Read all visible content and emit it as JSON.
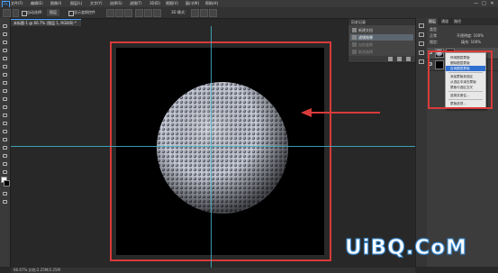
{
  "app": {
    "logo": "Ps",
    "menus": [
      "文件(F)",
      "编辑(E)",
      "图像(I)",
      "图层(L)",
      "文字(Y)",
      "选择(S)",
      "滤镜(T)",
      "3D(D)",
      "视图(V)",
      "窗口(W)",
      "帮助(H)"
    ],
    "window_controls": [
      "—",
      "□",
      "✕"
    ]
  },
  "options_bar": {
    "auto_select_label": "自动选择：",
    "auto_select_target": "图层",
    "show_transform_label": "显示变换控件",
    "mode_3d_label": "3D 模式："
  },
  "document": {
    "tab_label": "未标题-1 @ 66.7% (图层 1, RGB/8) *",
    "status_text": "66.67%   文档:2.25M/2.25M"
  },
  "canvas": {
    "background_color": "#282828",
    "artboard_color": "#000000",
    "highlight_color": "#d93a3a",
    "guide_color": "#3fb4c8"
  },
  "history_panel": {
    "title": "历史记录",
    "items": [
      {
        "label": "新建文档",
        "state": "normal"
      },
      {
        "label": "滤镜效果",
        "state": "selected"
      },
      {
        "label": "自由变换",
        "state": "dimmed"
      },
      {
        "label": "取消选择",
        "state": "dimmed"
      }
    ]
  },
  "layers_panel": {
    "tabs": [
      "图层",
      "通道",
      "路径"
    ],
    "kind_label": "类型",
    "blend_mode": "正常",
    "opacity_label": "不透明度: 100%",
    "lock_label": "锁定:",
    "fill_label": "填充: 100%",
    "layers": [
      {
        "name": "图层 1",
        "kind": "sphere"
      },
      {
        "name": "背景",
        "kind": "black"
      }
    ]
  },
  "context_menu": {
    "items": [
      {
        "label": "停用图层蒙版",
        "state": "normal"
      },
      {
        "label": "删除图层蒙版",
        "state": "normal"
      },
      {
        "label": "应用图层蒙版",
        "state": "highlighted"
      },
      {
        "label": "separator",
        "state": "separator"
      },
      {
        "label": "添加蒙版到选区",
        "state": "normal"
      },
      {
        "label": "从选区中减去蒙版",
        "state": "normal"
      },
      {
        "label": "蒙版与选区交叉",
        "state": "normal"
      },
      {
        "label": "separator",
        "state": "separator"
      },
      {
        "label": "选择并遮住...",
        "state": "normal"
      },
      {
        "label": "separator",
        "state": "separator"
      },
      {
        "label": "蒙版选项...",
        "state": "normal"
      }
    ]
  },
  "watermark": {
    "text": "UiBQ.CoM"
  }
}
